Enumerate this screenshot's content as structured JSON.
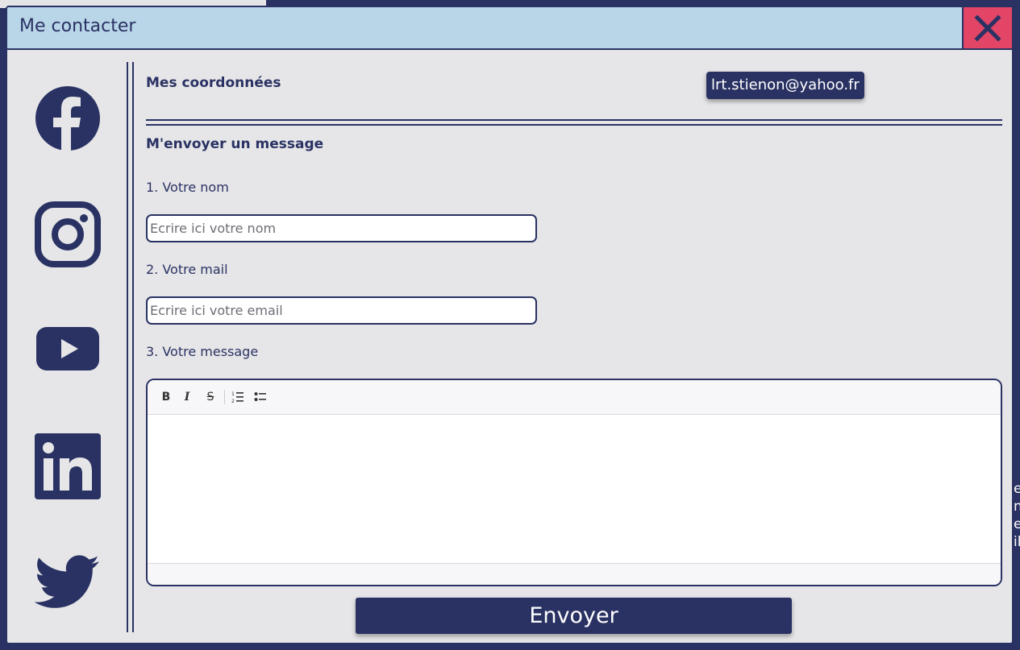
{
  "window": {
    "title": "Me contacter"
  },
  "social": [
    "facebook-icon",
    "instagram-icon",
    "youtube-icon",
    "linkedin-icon",
    "twitter-icon"
  ],
  "contact": {
    "heading": "Mes coordonnées",
    "email": "lrt.stienon@yahoo.fr"
  },
  "form": {
    "heading": "M'envoyer un message",
    "name_label": "1. Votre nom",
    "name_placeholder": "Ecrire ici votre nom",
    "name_value": "",
    "email_label": "2. Votre mail",
    "email_placeholder": "Ecrire ici votre email",
    "email_value": "",
    "message_label": "3. Votre message",
    "message_value": "",
    "toolbar": {
      "bold": "B",
      "italic": "I",
      "strike": "S"
    },
    "submit_label": "Envoyer"
  },
  "colors": {
    "navy": "#2a3263",
    "titlebar": "#b9d5e8",
    "close": "#e24566",
    "panel": "#e6e6e8"
  }
}
